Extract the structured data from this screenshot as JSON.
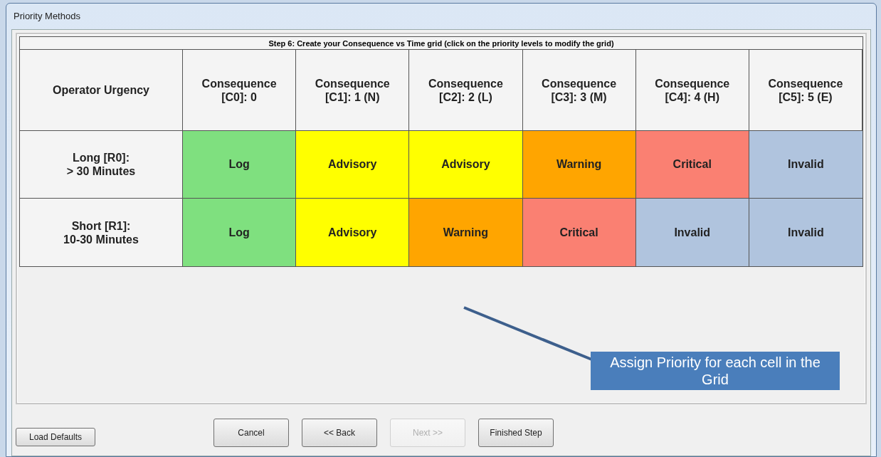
{
  "window": {
    "title": "Priority Methods"
  },
  "grid": {
    "caption": "Step 6: Create your Consequence vs Time grid (click on the priority levels to modify the grid)",
    "corner": "Operator Urgency",
    "columns": [
      "Consequence\n[C0]: 0",
      "Consequence\n[C1]: 1 (N)",
      "Consequence\n[C2]: 2 (L)",
      "Consequence\n[C3]: 3 (M)",
      "Consequence\n[C4]: 4 (H)",
      "Consequence\n[C5]: 5 (E)"
    ],
    "rows": [
      {
        "label": "Long [R0]:\n> 30 Minutes",
        "cells": [
          {
            "text": "Log",
            "color": "#7fe07f"
          },
          {
            "text": "Advisory",
            "color": "#ffff00"
          },
          {
            "text": "Advisory",
            "color": "#ffff00"
          },
          {
            "text": "Warning",
            "color": "#ffa500"
          },
          {
            "text": "Critical",
            "color": "#fa8072"
          },
          {
            "text": "Invalid",
            "color": "#b0c4de"
          }
        ]
      },
      {
        "label": "Short [R1]:\n10-30 Minutes",
        "cells": [
          {
            "text": "Log",
            "color": "#7fe07f"
          },
          {
            "text": "Advisory",
            "color": "#ffff00"
          },
          {
            "text": "Warning",
            "color": "#ffa500"
          },
          {
            "text": "Critical",
            "color": "#fa8072"
          },
          {
            "text": "Invalid",
            "color": "#b0c4de"
          },
          {
            "text": "Invalid",
            "color": "#b0c4de"
          }
        ]
      }
    ]
  },
  "callout": {
    "text": "Assign Priority for each cell in the Grid"
  },
  "buttons": [
    {
      "label": "Load Defaults",
      "disabled": false
    },
    {
      "label": "Cancel",
      "disabled": false
    },
    {
      "label": "<< Back",
      "disabled": false
    },
    {
      "label": "Next >>",
      "disabled": true
    },
    {
      "label": "Finished Step",
      "disabled": false
    }
  ]
}
